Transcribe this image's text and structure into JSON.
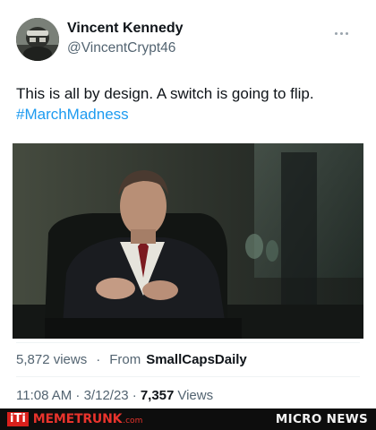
{
  "tweet": {
    "author": {
      "display_name": "Vincent Kennedy",
      "handle": "@VincentCrypt46"
    },
    "text": "This is all by design. A switch is going to flip.",
    "hashtag": "#MarchMadness",
    "stats": {
      "views": "5,872 views",
      "separator": "·",
      "from_label": "From",
      "source": "SmallCapsDaily"
    },
    "timestamp": {
      "time_date": "11:08 AM · 3/12/23 ·",
      "view_count": "7,357",
      "views_label": "Views"
    }
  },
  "footer": {
    "logo_mark": "iTi",
    "brand_name": "MEMETRUNK",
    "brand_suffix": ".com",
    "right_label": "MICRO NEWS"
  },
  "colors": {
    "hashtag": "#1d9bf0",
    "muted": "#536471",
    "footer_bg": "#0d0d0d",
    "footer_brand": "#e8332c"
  },
  "icons": [
    "more-options-icon",
    "avatar-image"
  ]
}
